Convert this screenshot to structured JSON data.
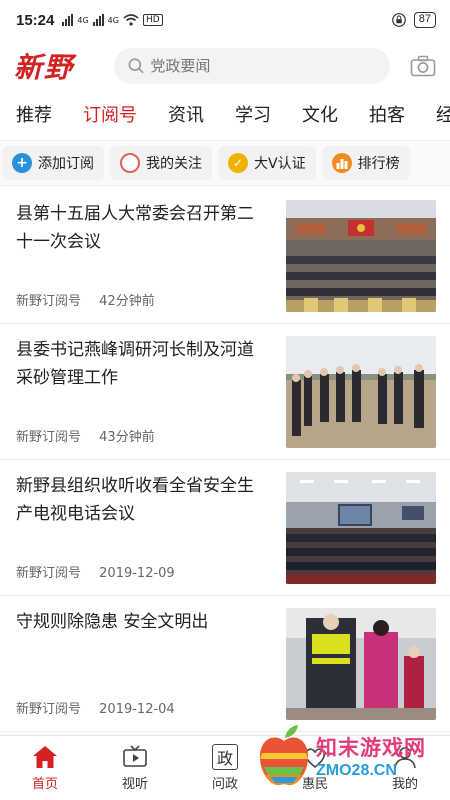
{
  "status_bar": {
    "time": "15:24",
    "network_labels": [
      "4G",
      "4G",
      "HD"
    ],
    "battery": "87"
  },
  "header": {
    "logo_text": "新野",
    "search_placeholder": "党政要闻"
  },
  "tabs": [
    {
      "label": "推荐",
      "active": false
    },
    {
      "label": "订阅号",
      "active": true
    },
    {
      "label": "资讯",
      "active": false
    },
    {
      "label": "学习",
      "active": false
    },
    {
      "label": "文化",
      "active": false
    },
    {
      "label": "拍客",
      "active": false
    },
    {
      "label": "经",
      "active": false
    }
  ],
  "actions": [
    {
      "label": "添加订阅",
      "icon": "plus-icon",
      "color": "#2a8fdc"
    },
    {
      "label": "我的关注",
      "icon": "circle-icon",
      "color": "#e06060"
    },
    {
      "label": "大V认证",
      "icon": "check-badge-icon",
      "color": "#f0b400"
    },
    {
      "label": "排行榜",
      "icon": "bar-chart-icon",
      "color": "#f08c1e"
    }
  ],
  "news": [
    {
      "title": "县第十五届人大常委会召开第二十一次会议",
      "source": "新野订阅号",
      "time": "42分钟前"
    },
    {
      "title": "县委书记燕峰调研河长制及河道采砂管理工作",
      "source": "新野订阅号",
      "time": "43分钟前"
    },
    {
      "title": "新野县组织收听收看全省安全生产电视电话会议",
      "source": "新野订阅号",
      "time": "2019-12-09"
    },
    {
      "title": "守规则除隐患 安全文明出",
      "source": "新野订阅号",
      "time": "2019-12-04"
    }
  ],
  "bottom_nav": [
    {
      "label": "首页",
      "icon": "home-icon",
      "active": true
    },
    {
      "label": "视听",
      "icon": "tv-icon",
      "active": false
    },
    {
      "label": "问政",
      "icon": "wenzheng-icon",
      "icon_text": "政",
      "active": false
    },
    {
      "label": "惠民",
      "icon": "huimin-icon",
      "active": false
    },
    {
      "label": "我的",
      "icon": "profile-icon",
      "active": false
    }
  ],
  "watermark": {
    "line1": "知末游戏网",
    "line2": "ZMO28.CN"
  },
  "colors": {
    "accent": "#d42222",
    "text": "#222222",
    "meta": "#666666"
  }
}
